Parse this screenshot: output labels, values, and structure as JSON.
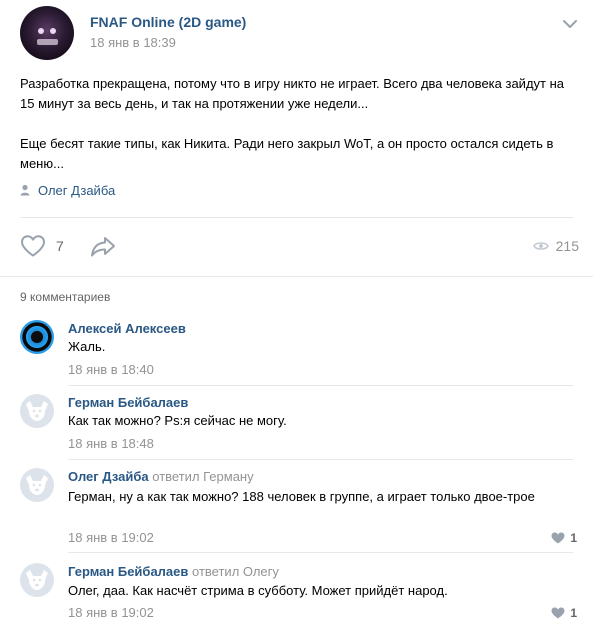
{
  "post": {
    "group_name": "FNAF Online (2D game)",
    "date": "18 янв в 18:39",
    "paragraphs": [
      "Разработка прекращена, потому что в игру никто не играет. Всего два человека зайдут на 15 минут за весь день, и так на протяжении уже недели...",
      "Еще бесят такие типы, как Никита. Ради него закрыл WoT, а он просто остался сидеть в меню..."
    ],
    "signer": "Олег Дзайба",
    "likes": "7",
    "views": "215",
    "icons": {
      "menu": "chevron-down-icon",
      "signer": "person-icon",
      "like": "heart-icon",
      "share": "share-arrow-icon",
      "views": "eye-icon"
    }
  },
  "comments_header": "9 комментариев",
  "comments": [
    {
      "author": "Алексей Алексеев",
      "replied_to": "",
      "text": "Жаль.",
      "date": "18 янв в 18:40",
      "likes": "",
      "avatar": "portal"
    },
    {
      "author": "Герман Бейбалаев",
      "replied_to": "",
      "text": "Как так можно? Ps:я сейчас не могу.",
      "date": "18 янв в 18:48",
      "likes": "",
      "avatar": "dog"
    },
    {
      "author": "Олег Дзайба",
      "replied_to": "ответил Герману",
      "text": "Герман, ну а как так можно? 188 человек в группе, а играет только двое-трое",
      "date": "18 янв в 19:02",
      "likes": "1",
      "avatar": "dog"
    },
    {
      "author": "Герман Бейбалаев",
      "replied_to": "ответил Олегу",
      "text": "Олег, даа. Как насчёт стрима в субботу. Может прийдёт народ.",
      "date": "18 янв в 19:02",
      "likes": "1",
      "avatar": "dog"
    }
  ],
  "colors": {
    "link": "#2a5885",
    "muted": "#939393",
    "divider": "#e7e8ec",
    "icon": "#99a2ad"
  }
}
